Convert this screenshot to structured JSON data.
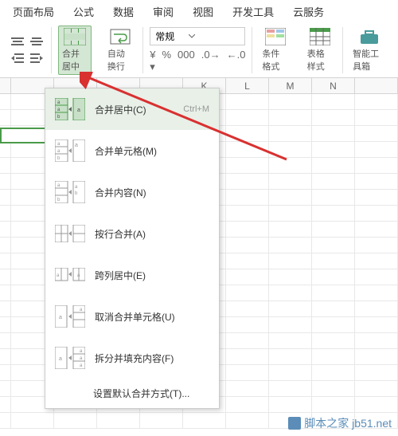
{
  "tabs": [
    "页面布局",
    "公式",
    "数据",
    "审阅",
    "视图",
    "开发工具",
    "云服务"
  ],
  "ribbon": {
    "merge_label": "合并居中",
    "wrap_label": "自动换行",
    "num_format": "常规",
    "cond_fmt": "条件格式",
    "table_style": "表格样式",
    "smart_tool": "智能工具箱"
  },
  "menu": {
    "items": [
      {
        "label": "合并居中(C)",
        "shortcut": "Ctrl+M"
      },
      {
        "label": "合并单元格(M)"
      },
      {
        "label": "合并内容(N)"
      },
      {
        "label": "按行合并(A)"
      },
      {
        "label": "跨列居中(E)"
      },
      {
        "label": "取消合并单元格(U)"
      },
      {
        "label": "拆分并填充内容(F)"
      }
    ],
    "default_text": "设置默认合并方式(T)..."
  },
  "columns": [
    "",
    "",
    "",
    "",
    "",
    "K",
    "L",
    "M",
    "N",
    ""
  ],
  "watermark": "脚本之家 jb51.net"
}
